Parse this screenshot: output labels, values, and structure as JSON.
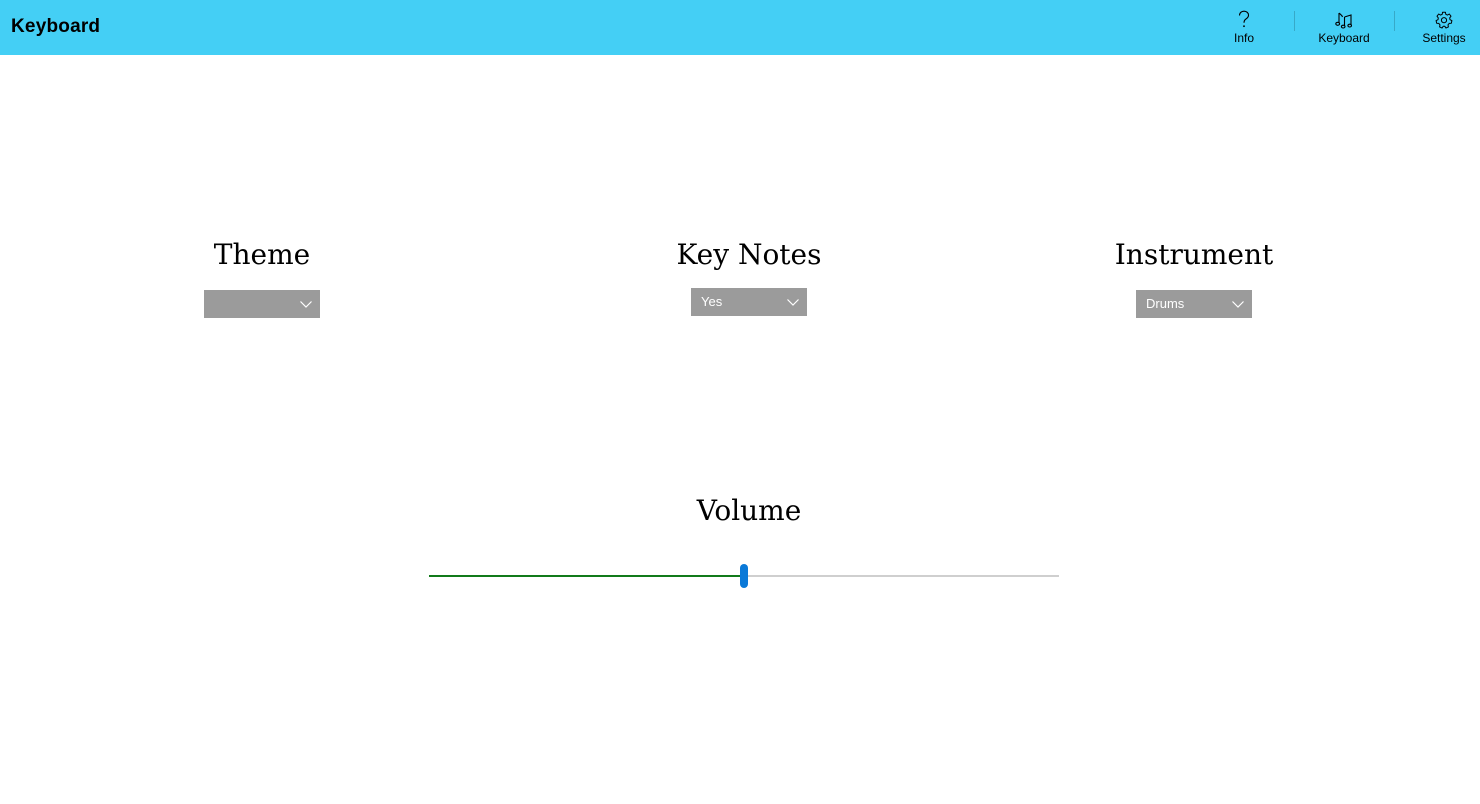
{
  "app": {
    "title": "Keyboard"
  },
  "nav": {
    "items": [
      {
        "label": "Info",
        "icon": "question-icon"
      },
      {
        "label": "Keyboard",
        "icon": "music-note-icon"
      },
      {
        "label": "Settings",
        "icon": "gear-icon"
      }
    ]
  },
  "settings": {
    "theme": {
      "label": "Theme",
      "selected": ""
    },
    "key_notes": {
      "label": "Key Notes",
      "selected": "Yes"
    },
    "instrument": {
      "label": "Instrument",
      "selected": "Drums"
    },
    "volume": {
      "label": "Volume",
      "value": 0.5
    }
  },
  "colors": {
    "topbar": "#44cff5",
    "combo_bg": "#9b9b9b",
    "slider_fill": "#117a1a",
    "slider_thumb": "#0a79d8",
    "slider_track": "#cfcfcf"
  }
}
